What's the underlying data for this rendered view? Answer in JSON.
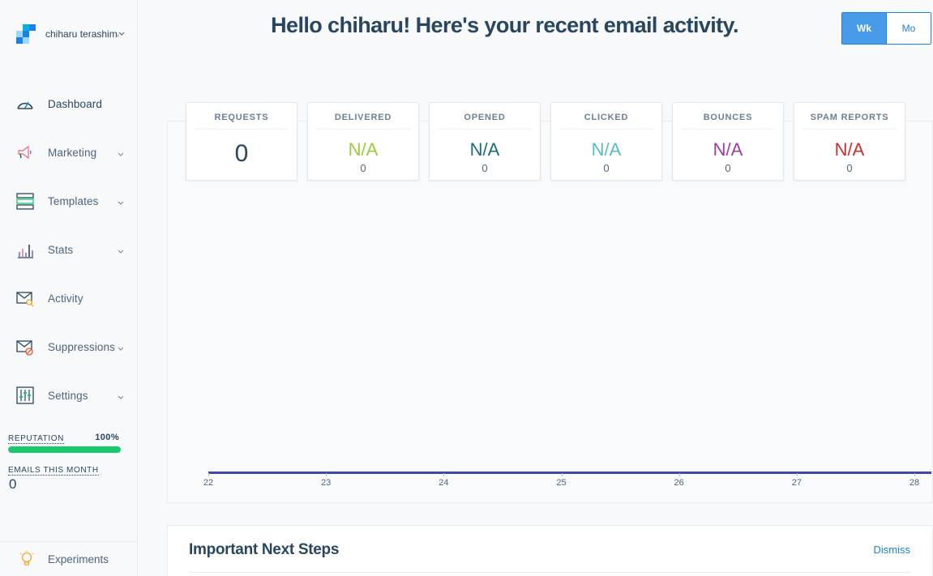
{
  "account": {
    "name": "chiharu terashima",
    "logo_icon": "sendgrid-logo-icon",
    "caret_icon": "chevron-down-icon"
  },
  "nav": [
    {
      "label": "Dashboard",
      "icon": "speedometer-icon",
      "expandable": false,
      "active": true
    },
    {
      "label": "Marketing",
      "icon": "megaphone-icon",
      "expandable": true
    },
    {
      "label": "Templates",
      "icon": "template-layout-icon",
      "expandable": true
    },
    {
      "label": "Stats",
      "icon": "bar-chart-icon",
      "expandable": true
    },
    {
      "label": "Activity",
      "icon": "envelope-search-icon",
      "expandable": false
    },
    {
      "label": "Suppressions",
      "icon": "envelope-blocked-icon",
      "expandable": true
    },
    {
      "label": "Settings",
      "icon": "sliders-icon",
      "expandable": true
    }
  ],
  "reputation": {
    "label": "REPUTATION",
    "value": "100%",
    "level": 1.0,
    "color": "#18c96e"
  },
  "emails_this_month": {
    "label": "EMAILS THIS MONTH",
    "value": "0"
  },
  "experiments": {
    "label": "Experiments",
    "icon": "lightbulb-icon"
  },
  "header": {
    "title": "Hello chiharu! Here's your recent email activity."
  },
  "period_toggle": {
    "options": [
      "Wk",
      "Mo"
    ],
    "selected": "Wk"
  },
  "stats": [
    {
      "title": "REQUESTS",
      "value": "0",
      "count": "",
      "color": "#294661"
    },
    {
      "title": "DELIVERED",
      "value": "N/A",
      "count": "0",
      "color": "#9ccc3d"
    },
    {
      "title": "OPENED",
      "value": "N/A",
      "count": "0",
      "color": "#1b6d7a"
    },
    {
      "title": "CLICKED",
      "value": "N/A",
      "count": "0",
      "color": "#59bcc9"
    },
    {
      "title": "BOUNCES",
      "value": "N/A",
      "count": "0",
      "color": "#9c3ea0"
    },
    {
      "title": "SPAM REPORTS",
      "value": "N/A",
      "count": "0",
      "color": "#c9312c"
    }
  ],
  "chart_data": {
    "type": "line",
    "x": [
      "22",
      "23",
      "24",
      "25",
      "26",
      "27",
      "28"
    ],
    "series": [
      {
        "values": [
          0,
          0,
          0,
          0,
          0,
          0,
          0
        ]
      }
    ],
    "title": "",
    "xlabel": "",
    "ylabel": "",
    "line_color": "#3f48a8",
    "grid": false
  },
  "next_steps": {
    "title": "Important Next Steps",
    "dismiss_label": "Dismiss"
  }
}
